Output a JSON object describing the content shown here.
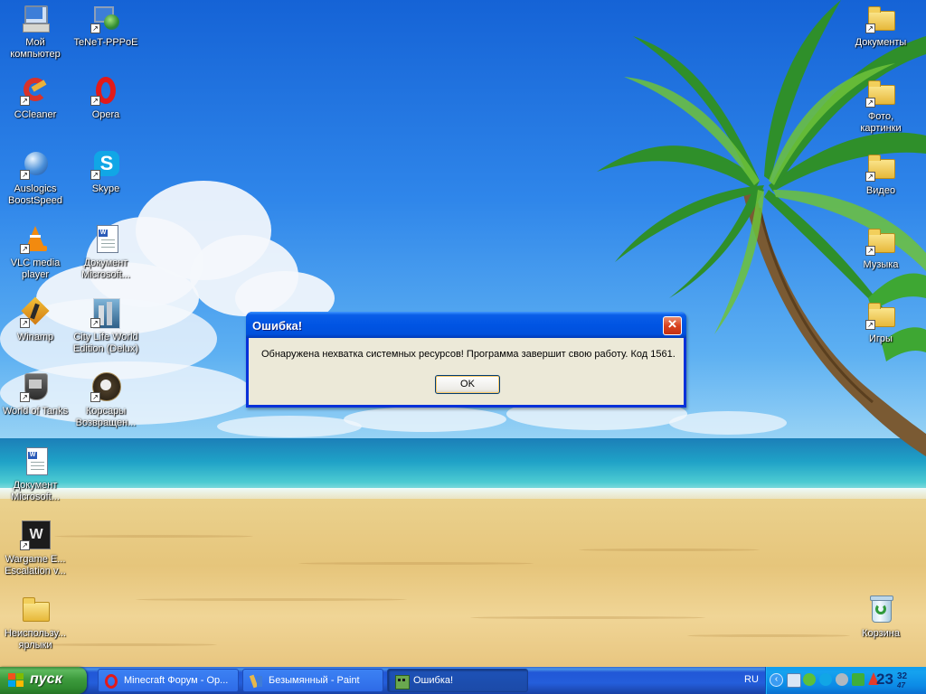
{
  "desktop": {
    "icons_left": [
      {
        "label": "Мой\nкомпьютер",
        "icon": "my-computer-icon"
      },
      {
        "label": "TeNeT-PPPoE",
        "icon": "network-connection-icon"
      },
      {
        "label": "CCleaner",
        "icon": "ccleaner-icon"
      },
      {
        "label": "Opera",
        "icon": "opera-icon"
      },
      {
        "label": "Auslogics\nBoostSpeed",
        "icon": "auslogics-icon"
      },
      {
        "label": "Skype",
        "icon": "skype-icon"
      },
      {
        "label": "VLC media\nplayer",
        "icon": "vlc-icon"
      },
      {
        "label": "Документ\nMicrosoft...",
        "icon": "word-document-icon"
      },
      {
        "label": "Winamp",
        "icon": "winamp-icon"
      },
      {
        "label": "City Life World\nEdition (Delux)",
        "icon": "city-life-icon"
      },
      {
        "label": "World of Tanks",
        "icon": "world-of-tanks-icon"
      },
      {
        "label": "Корсары\nВозвращен...",
        "icon": "corsairs-icon"
      },
      {
        "label": "Документ\nMicrosoft...",
        "icon": "word-document-icon"
      },
      {
        "label": "Wargame E...\nEscalation v...",
        "icon": "wargame-icon"
      },
      {
        "label": "Неиспользу...\nярлыки",
        "icon": "folder-icon"
      }
    ],
    "icons_right": [
      {
        "label": "Документы",
        "icon": "folder-icon"
      },
      {
        "label": "Фото,\nкартинки",
        "icon": "folder-icon"
      },
      {
        "label": "Видео",
        "icon": "folder-icon"
      },
      {
        "label": "Музыка",
        "icon": "folder-icon"
      },
      {
        "label": "Игры",
        "icon": "folder-icon"
      },
      {
        "label": "Корзина",
        "icon": "recycle-bin-icon"
      }
    ]
  },
  "dialog": {
    "title": "Ошибка!",
    "message": "Обнаружена нехватка системных ресурсов! Программа завершит свою работу. Код 1561.",
    "ok_label": "OK",
    "close_icon": "close-icon"
  },
  "taskbar": {
    "start_label": "пуск",
    "tasks": [
      {
        "label": "Minecraft Форум - Op...",
        "icon": "opera-icon",
        "active": false
      },
      {
        "label": "Безымянный - Paint",
        "icon": "paint-icon",
        "active": false
      },
      {
        "label": "Ошибка!",
        "icon": "minecraft-icon",
        "active": true
      }
    ],
    "language": "RU",
    "clock_hours": "23",
    "clock_minutes": "32",
    "clock_seconds": "47"
  }
}
